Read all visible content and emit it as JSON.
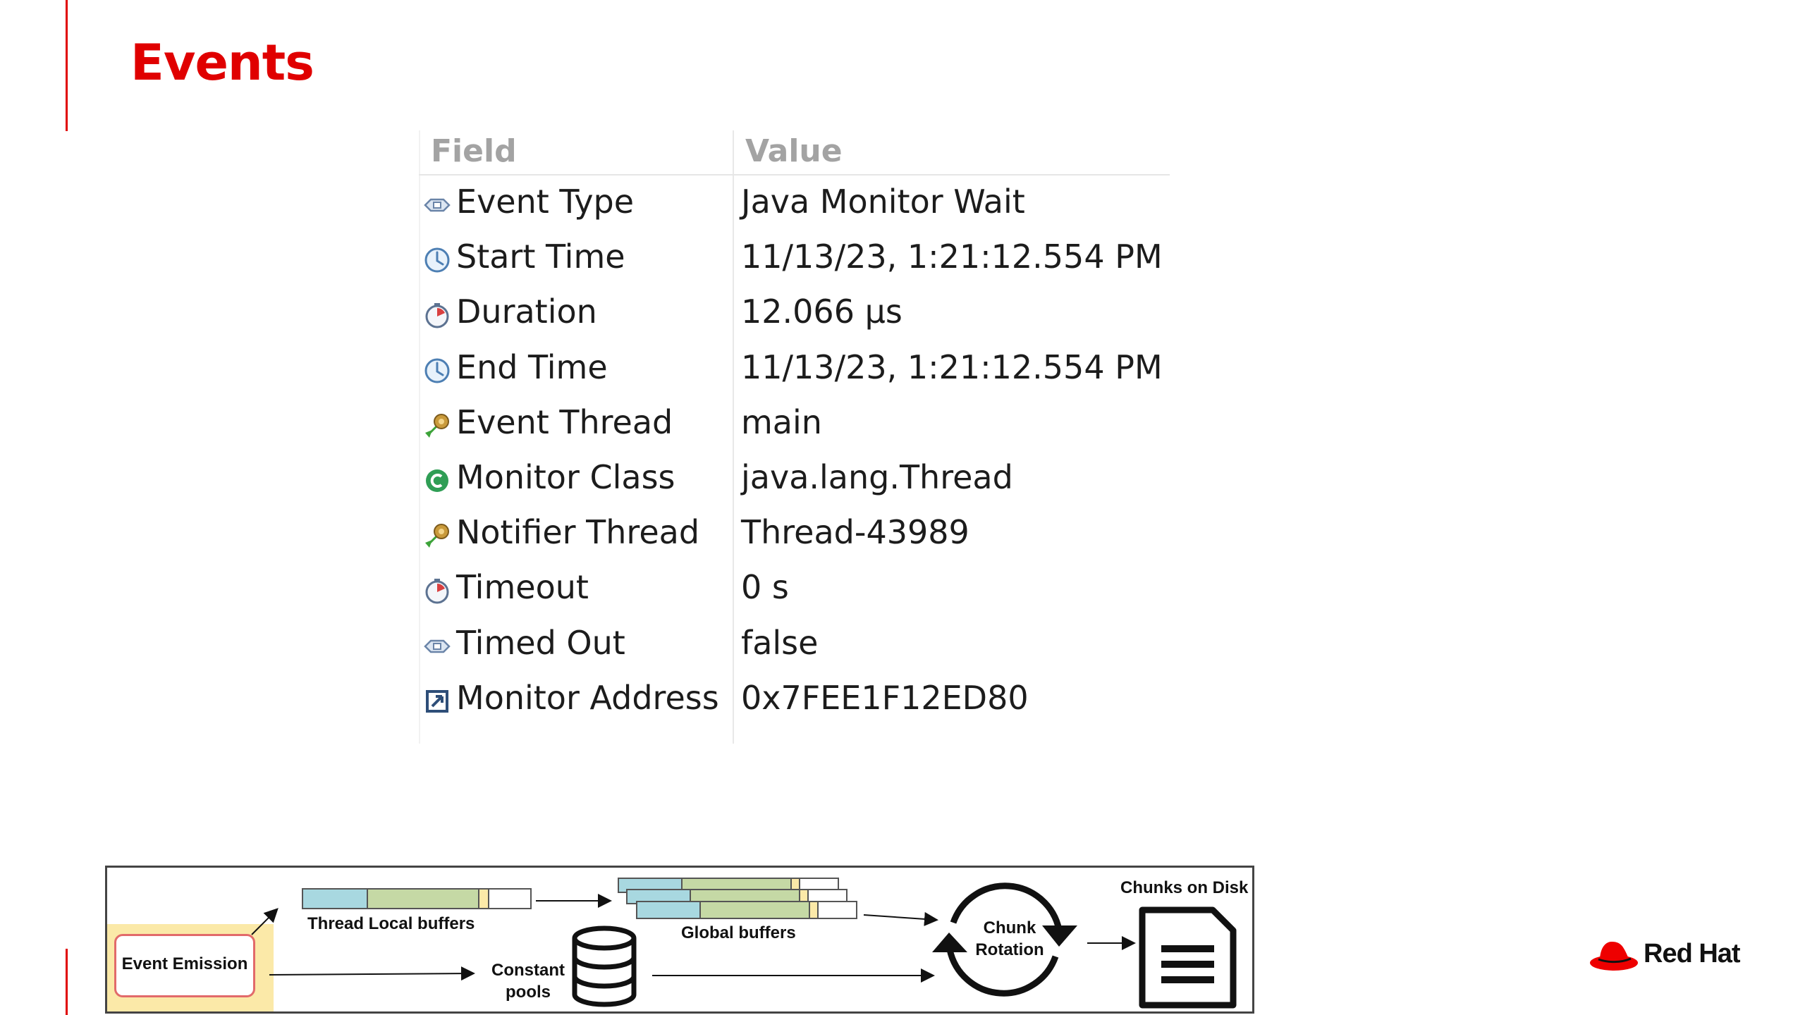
{
  "slide": {
    "title": "Events",
    "accent_color": "#e00000"
  },
  "table": {
    "headers": {
      "field": "Field",
      "value": "Value"
    },
    "rows": [
      {
        "field": "Event Type",
        "value": "Java Monitor Wait",
        "icon": "event-type-icon"
      },
      {
        "field": "Start Time",
        "value": "11/13/23, 1:21:12.554 PM",
        "icon": "clock-icon"
      },
      {
        "field": "Duration",
        "value": "12.066 µs",
        "icon": "stopwatch-icon"
      },
      {
        "field": "End Time",
        "value": "11/13/23, 1:21:12.554 PM",
        "icon": "clock-icon"
      },
      {
        "field": "Event Thread",
        "value": "main",
        "icon": "thread-icon"
      },
      {
        "field": "Monitor Class",
        "value": "java.lang.Thread",
        "icon": "class-icon"
      },
      {
        "field": "Notifier Thread",
        "value": "Thread-43989",
        "icon": "thread-icon"
      },
      {
        "field": "Timeout",
        "value": "0 s",
        "icon": "stopwatch-icon"
      },
      {
        "field": "Timed Out",
        "value": "false",
        "icon": "event-type-icon"
      },
      {
        "field": "Monitor Address",
        "value": "0x7FEE1F12ED80",
        "icon": "address-icon"
      }
    ]
  },
  "diagram": {
    "event_emission": "Event Emission",
    "thread_local_buffers": "Thread Local buffers",
    "global_buffers": "Global buffers",
    "constant_pools_line1": "Constant",
    "constant_pools_line2": "pools",
    "chunk_rotation_line1": "Chunk",
    "chunk_rotation_line2": "Rotation",
    "chunks_on_disk": "Chunks on Disk",
    "colors": {
      "blue_segment": "#a8d8e0",
      "green_segment": "#c5d9a5",
      "yellow_segment": "#fbe9a8"
    }
  },
  "brand": {
    "name": "Red Hat",
    "color": "#ee0000"
  }
}
